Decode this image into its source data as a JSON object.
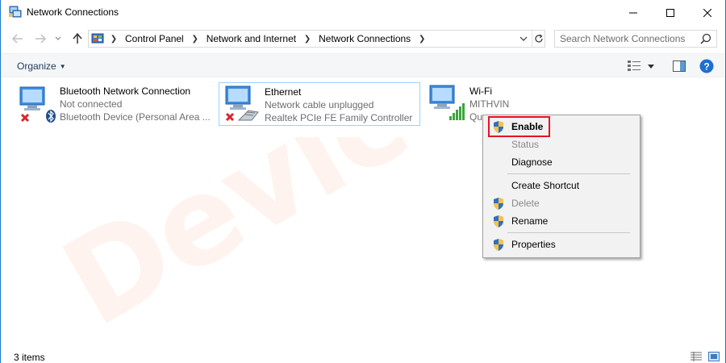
{
  "window": {
    "title": "Network Connections",
    "icon": "network-connections-icon"
  },
  "address_bar": {
    "breadcrumbs": [
      "Control Panel",
      "Network and Internet",
      "Network Connections"
    ]
  },
  "search": {
    "placeholder": "Search Network Connections"
  },
  "toolbar": {
    "organize_label": "Organize",
    "help_label": "?"
  },
  "items": [
    {
      "name": "Bluetooth Network Connection",
      "status": "Not connected",
      "device": "Bluetooth Device (Personal Area ...",
      "icon": "bluetooth-adapter-icon",
      "state": "disabled"
    },
    {
      "name": "Ethernet",
      "status": "Network cable unplugged",
      "device": "Realtek PCIe FE Family Controller",
      "icon": "ethernet-adapter-icon",
      "state": "unplugged",
      "selected": true
    },
    {
      "name": "Wi-Fi",
      "status": "MITHVIN",
      "device": "Qu",
      "icon": "wifi-adapter-icon",
      "state": "connected"
    }
  ],
  "context_menu": {
    "items": [
      {
        "label": "Enable",
        "shield": true,
        "bold": true,
        "disabled": false
      },
      {
        "label": "Status",
        "shield": false,
        "disabled": true
      },
      {
        "label": "Diagnose",
        "shield": false,
        "disabled": false
      },
      {
        "label": "Create Shortcut",
        "shield": false,
        "disabled": false
      },
      {
        "label": "Delete",
        "shield": true,
        "disabled": true
      },
      {
        "label": "Rename",
        "shield": true,
        "disabled": false
      },
      {
        "label": "Properties",
        "shield": true,
        "disabled": false
      }
    ]
  },
  "status_bar": {
    "count": "3 items"
  },
  "watermark": {
    "text": "DeviceTricks"
  },
  "colors": {
    "accent": "#1979ca",
    "highlight_red": "#e81123",
    "selection_border": "#99d1ff",
    "watermark": "#f26522"
  }
}
